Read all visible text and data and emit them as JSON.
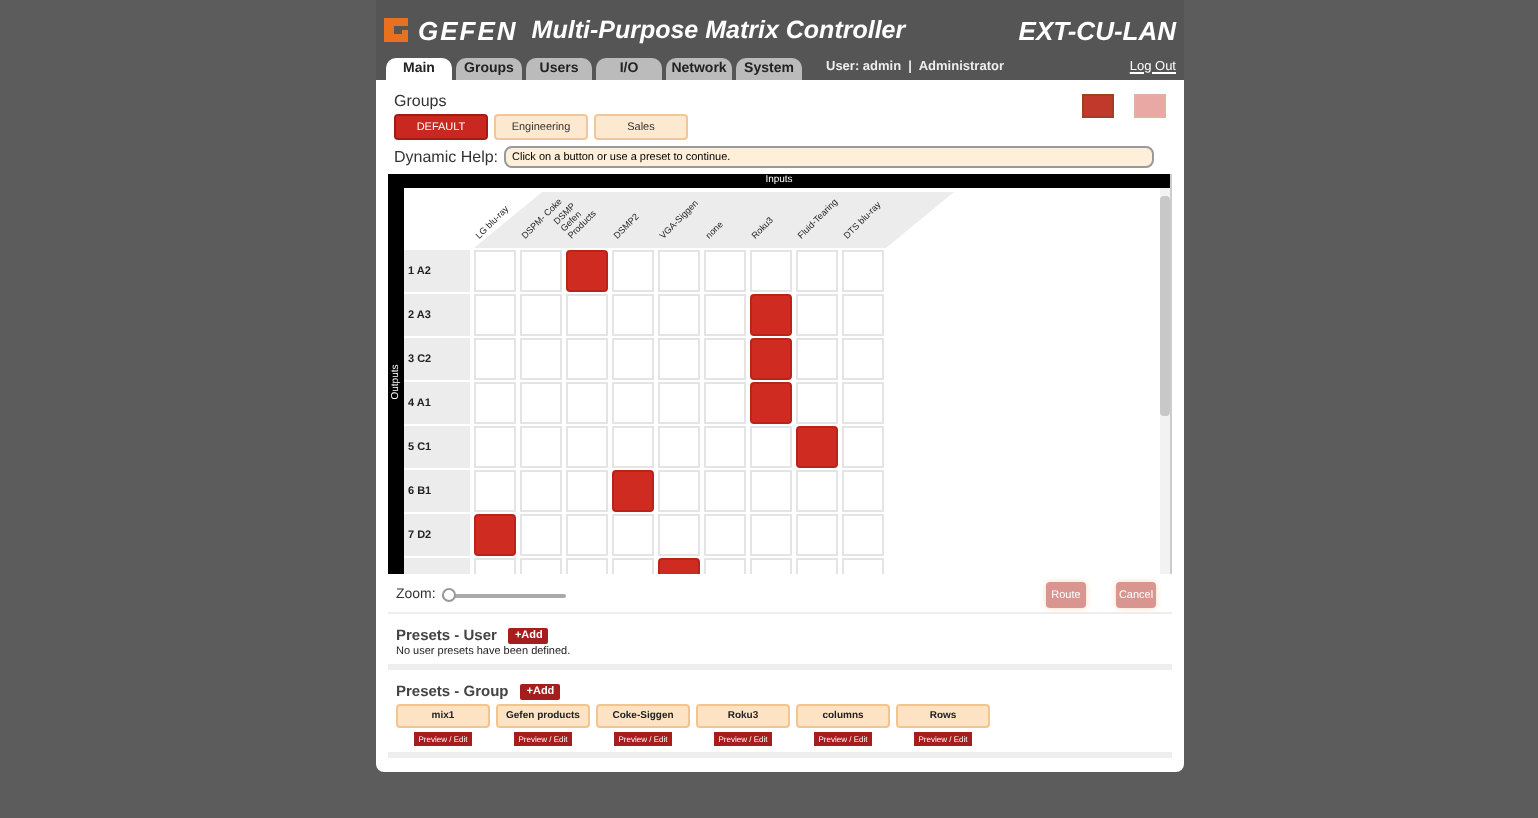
{
  "header": {
    "brand": "GEFEN",
    "title": "Multi-Purpose Matrix Controller",
    "model": "EXT-CU-LAN"
  },
  "tabs": [
    {
      "label": "Main",
      "selected": true
    },
    {
      "label": "Groups",
      "selected": false
    },
    {
      "label": "Users",
      "selected": false
    },
    {
      "label": "I/O",
      "selected": false
    },
    {
      "label": "Network",
      "selected": false
    },
    {
      "label": "System",
      "selected": false
    }
  ],
  "user_info": "User: admin  |  Administrator",
  "logout": "Log Out",
  "groups": {
    "title": "Groups",
    "items": [
      {
        "label": "DEFAULT",
        "selected": true
      },
      {
        "label": "Engineering",
        "selected": false
      },
      {
        "label": "Sales",
        "selected": false
      }
    ]
  },
  "dynamic_help": {
    "label": "Dynamic Help:",
    "text": "Click on a button or use a preset to continue."
  },
  "matrix": {
    "inputs_label": "Inputs",
    "outputs_label": "Outputs",
    "columns": [
      "LG blu-ray",
      "DSPM- Coke",
      "DSMP Gefen Products",
      "DSMP2",
      "VGA-Siggen",
      "none",
      "Roku3",
      "Fluid-Tearing",
      "DTS blu-ray"
    ],
    "rows": [
      {
        "label": "1 A2",
        "cells": [
          false,
          false,
          true,
          false,
          false,
          false,
          false,
          false,
          false
        ]
      },
      {
        "label": "2 A3",
        "cells": [
          false,
          false,
          false,
          false,
          false,
          false,
          true,
          false,
          false
        ]
      },
      {
        "label": "3 C2",
        "cells": [
          false,
          false,
          false,
          false,
          false,
          false,
          true,
          false,
          false
        ]
      },
      {
        "label": "4 A1",
        "cells": [
          false,
          false,
          false,
          false,
          false,
          false,
          true,
          false,
          false
        ]
      },
      {
        "label": "5 C1",
        "cells": [
          false,
          false,
          false,
          false,
          false,
          false,
          false,
          true,
          false
        ]
      },
      {
        "label": "6 B1",
        "cells": [
          false,
          false,
          false,
          true,
          false,
          false,
          false,
          false,
          false
        ]
      },
      {
        "label": "7 D2",
        "cells": [
          true,
          false,
          false,
          false,
          false,
          false,
          false,
          false,
          false
        ]
      },
      {
        "cells": [
          false,
          false,
          false,
          false,
          true,
          false,
          false,
          false,
          false
        ]
      }
    ]
  },
  "zoom": {
    "label": "Zoom:",
    "level": 0
  },
  "actions": [
    {
      "label": "Route",
      "disabled": true
    },
    {
      "label": "Cancel",
      "disabled": true
    }
  ],
  "presets_user": {
    "title": "Presets - User",
    "add": "+Add",
    "empty": "No user presets have been defined."
  },
  "presets_group": {
    "title": "Presets - Group",
    "add": "+Add",
    "items": [
      {
        "name": "mix1",
        "action": "Preview / Edit"
      },
      {
        "name": "Gefen products",
        "action": "Preview / Edit"
      },
      {
        "name": "Coke-Siggen",
        "action": "Preview / Edit"
      },
      {
        "name": "Roku3",
        "action": "Preview / Edit"
      },
      {
        "name": "columns",
        "action": "Preview / Edit"
      },
      {
        "name": "Rows",
        "action": "Preview / Edit"
      }
    ]
  }
}
